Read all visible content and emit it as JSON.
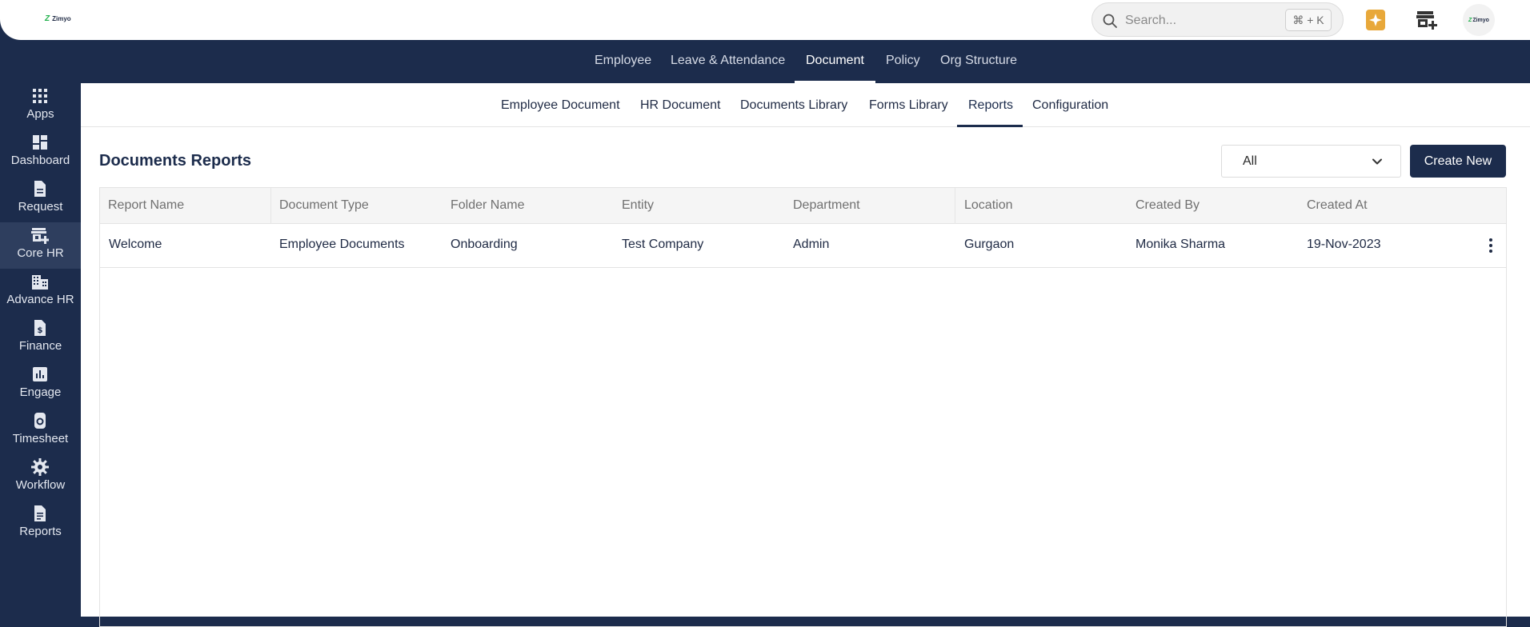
{
  "brand": {
    "logo_text": "Zimyo",
    "avatar_text": "Zimyo"
  },
  "search": {
    "placeholder": "Search...",
    "shortcut": "⌘ + K"
  },
  "main_nav": {
    "items": [
      {
        "label": "Employee"
      },
      {
        "label": "Leave & Attendance"
      },
      {
        "label": "Document",
        "active": true
      },
      {
        "label": "Policy"
      },
      {
        "label": "Org Structure"
      }
    ]
  },
  "sidebar": {
    "items": [
      {
        "label": "Apps",
        "icon": "apps-grid-icon"
      },
      {
        "label": "Dashboard",
        "icon": "dashboard-icon"
      },
      {
        "label": "Request",
        "icon": "document-icon"
      },
      {
        "label": "Core HR",
        "icon": "store-add-icon",
        "active": true
      },
      {
        "label": "Advance HR",
        "icon": "building-icon"
      },
      {
        "label": "Finance",
        "icon": "dollar-file-icon"
      },
      {
        "label": "Engage",
        "icon": "bar-chart-icon"
      },
      {
        "label": "Timesheet",
        "icon": "stopwatch-icon"
      },
      {
        "label": "Workflow",
        "icon": "gear-icon"
      },
      {
        "label": "Reports",
        "icon": "report-icon"
      }
    ]
  },
  "sub_nav": {
    "items": [
      {
        "label": "Employee Document"
      },
      {
        "label": "HR Document"
      },
      {
        "label": "Documents Library"
      },
      {
        "label": "Forms Library"
      },
      {
        "label": "Reports",
        "active": true
      },
      {
        "label": "Configuration"
      }
    ]
  },
  "page": {
    "title": "Documents Reports",
    "filter_value": "All",
    "create_button": "Create New"
  },
  "table": {
    "columns": [
      "Report Name",
      "Document Type",
      "Folder Name",
      "Entity",
      "Department",
      "Location",
      "Created By",
      "Created At"
    ],
    "rows": [
      [
        "Welcome",
        "Employee Documents",
        "Onboarding",
        "Test Company",
        "Admin",
        "Gurgaon",
        "Monika Sharma",
        "19-Nov-2023"
      ]
    ]
  },
  "colors": {
    "navy": "#1c2c4c",
    "accent": "#e8a83a",
    "logo_green": "#22b14c"
  }
}
